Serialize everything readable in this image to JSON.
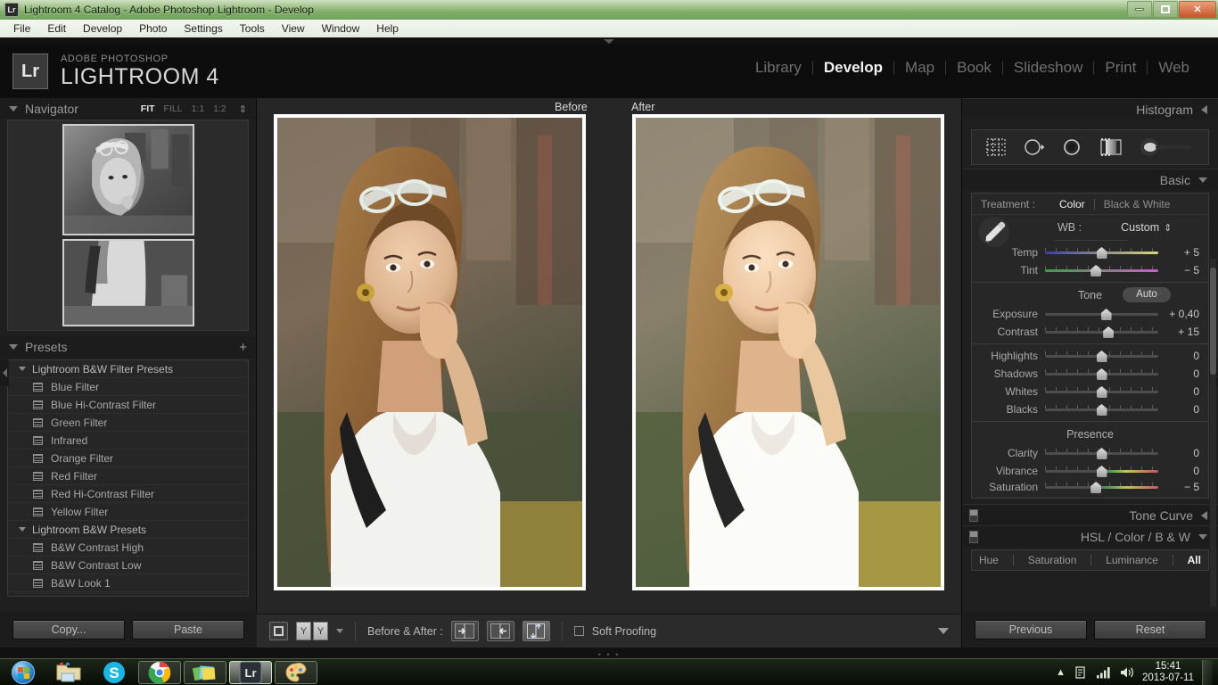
{
  "window": {
    "title": "Lightroom 4 Catalog - Adobe Photoshop Lightroom - Develop",
    "app_badge": "Lr",
    "minimize_label": "Minimize",
    "maximize_label": "Restore",
    "close_label": "Close"
  },
  "menubar": {
    "items": [
      "File",
      "Edit",
      "Develop",
      "Photo",
      "Settings",
      "Tools",
      "View",
      "Window",
      "Help"
    ]
  },
  "identity": {
    "badge": "Lr",
    "brand_sub": "ADOBE PHOTOSHOP",
    "brand_main": "LIGHTROOM 4"
  },
  "modules": {
    "items": [
      "Library",
      "Develop",
      "Map",
      "Book",
      "Slideshow",
      "Print",
      "Web"
    ],
    "active": "Develop"
  },
  "navigator": {
    "title": "Navigator",
    "zoom_levels": [
      "FIT",
      "FILL",
      "1:1",
      "1:2"
    ],
    "active_zoom": "FIT",
    "stepper_icon": "up-down-stepper-icon"
  },
  "presets": {
    "title": "Presets",
    "add_icon": "plus-icon",
    "groups": [
      {
        "label": "Lightroom B&W Filter Presets",
        "items": [
          "Blue Filter",
          "Blue Hi-Contrast Filter",
          "Green Filter",
          "Infrared",
          "Orange Filter",
          "Red Filter",
          "Red Hi-Contrast Filter",
          "Yellow Filter"
        ]
      },
      {
        "label": "Lightroom B&W Presets",
        "items": [
          "B&W Contrast High",
          "B&W Contrast Low",
          "B&W Look 1"
        ]
      }
    ]
  },
  "left_footer": {
    "copy_label": "Copy...",
    "paste_label": "Paste"
  },
  "center": {
    "before_label": "Before",
    "after_label": "After"
  },
  "toolbar": {
    "view_mode_icon": "loupe-view-icon",
    "compare_label": "YY",
    "dropdown_icon": "chevron-down-icon",
    "before_after_label": "Before & After :",
    "mode_left_right_icon": "before-after-left-right-icon",
    "mode_right_left_icon": "before-after-right-left-icon",
    "mode_top_bottom_icon": "before-after-top-bottom-icon",
    "soft_proofing_label": "Soft Proofing",
    "soft_proofing_checked": false,
    "panel_toggle_icon": "chevron-down-icon"
  },
  "right_panel": {
    "histogram": {
      "title": "Histogram",
      "collapse_icon": "triangle-left-icon",
      "tools": [
        "crop-overlay-icon",
        "spot-removal-icon",
        "red-eye-correction-icon",
        "graduated-filter-icon",
        "adjustment-brush-icon"
      ]
    },
    "basic": {
      "title": "Basic",
      "expand_icon": "triangle-down-icon",
      "treatment_label": "Treatment :",
      "treatment_options": [
        "Color",
        "Black & White"
      ],
      "treatment_active": "Color",
      "wb_label": "WB :",
      "wb_value": "Custom",
      "wb_stepper_icon": "up-down-stepper-icon",
      "eyedropper_icon": "eyedropper-icon",
      "wb_sliders": [
        {
          "name": "Temp",
          "value": "+ 5",
          "pos": 50,
          "track": "temp"
        },
        {
          "name": "Tint",
          "value": "− 5",
          "pos": 45,
          "track": "tint"
        }
      ],
      "tone_label": "Tone",
      "auto_label": "Auto",
      "tone_sliders": [
        {
          "name": "Exposure",
          "value": "+ 0,40",
          "pos": 54,
          "track": "plain"
        },
        {
          "name": "Contrast",
          "value": "+ 15",
          "pos": 56,
          "track": "plain"
        },
        {
          "name": "Highlights",
          "value": "0",
          "pos": 50,
          "track": "plain"
        },
        {
          "name": "Shadows",
          "value": "0",
          "pos": 50,
          "track": "plain"
        },
        {
          "name": "Whites",
          "value": "0",
          "pos": 50,
          "track": "plain"
        },
        {
          "name": "Blacks",
          "value": "0",
          "pos": 50,
          "track": "plain"
        }
      ],
      "presence_label": "Presence",
      "presence_sliders": [
        {
          "name": "Clarity",
          "value": "0",
          "pos": 50,
          "track": "plain"
        },
        {
          "name": "Vibrance",
          "value": "0",
          "pos": 50,
          "track": "vib"
        },
        {
          "name": "Saturation",
          "value": "− 5",
          "pos": 45,
          "track": "sat"
        }
      ]
    },
    "tone_curve": {
      "title": "Tone Curve",
      "collapse_icon": "triangle-left-icon",
      "switch_icon": "panel-switch-icon"
    },
    "hsl": {
      "title": "HSL  /  Color  /  B & W",
      "expand_icon": "triangle-down-icon",
      "switch_icon": "panel-switch-icon",
      "tabs": [
        "Hue",
        "Saturation",
        "Luminance",
        "All"
      ],
      "active_tab": "All"
    },
    "footer": {
      "previous_label": "Previous",
      "reset_label": "Reset"
    }
  },
  "taskbar": {
    "start_icon": "windows-start-orb-icon",
    "apps": [
      {
        "icon": "file-explorer-icon",
        "state": "plain"
      },
      {
        "icon": "skype-icon",
        "state": "plain"
      },
      {
        "icon": "google-chrome-icon",
        "state": "framed"
      },
      {
        "icon": "picasa-icon",
        "state": "framed"
      },
      {
        "icon": "lightroom-icon",
        "state": "active"
      },
      {
        "icon": "paint-icon",
        "state": "framed"
      }
    ],
    "tray": {
      "show_hidden_icon": "chevron-up-icon",
      "action_center_icon": "action-center-icon",
      "network_icon": "network-signal-icon",
      "volume_icon": "speaker-icon"
    },
    "clock_time": "15:41",
    "clock_date": "2013-07-11",
    "show_desktop_label": "Show desktop"
  },
  "colors": {
    "panel_bg": "#1f1f1f",
    "canvas_bg": "#262626",
    "text_dim": "#9a9a9a",
    "text_bright": "#f0f0f0",
    "title_green": "#7fae68"
  }
}
